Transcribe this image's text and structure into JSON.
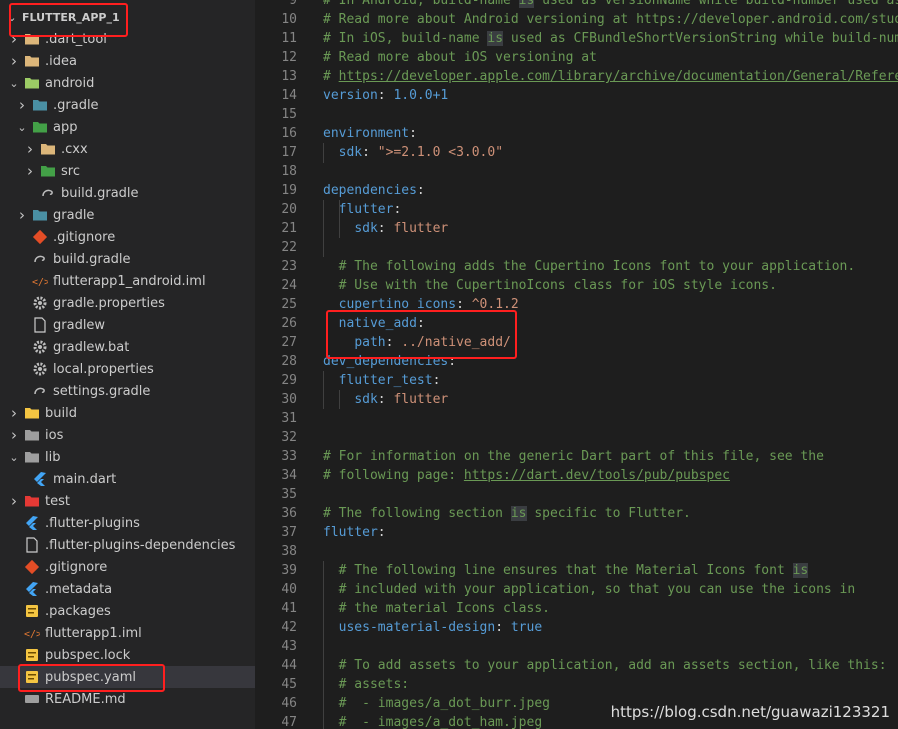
{
  "explorer": {
    "root": "FLUTTER_APP_1",
    "items": [
      {
        "label": ".dart_tool",
        "depth": 1,
        "twisty": "right",
        "icon": "folder-tools-icon",
        "color": "#dcb67a"
      },
      {
        "label": ".idea",
        "depth": 1,
        "twisty": "right",
        "icon": "folder-idea-icon",
        "color": "#dcb67a"
      },
      {
        "label": "android",
        "depth": 1,
        "twisty": "down",
        "icon": "folder-android-icon",
        "color": "#9ccc65"
      },
      {
        "label": ".gradle",
        "depth": 2,
        "twisty": "right",
        "icon": "folder-gradle-icon",
        "color": "#4a90a4"
      },
      {
        "label": "app",
        "depth": 2,
        "twisty": "down",
        "icon": "folder-app-icon",
        "color": "#43a047"
      },
      {
        "label": ".cxx",
        "depth": 3,
        "twisty": "right",
        "icon": "folder-icon",
        "color": "#dcb67a"
      },
      {
        "label": "src",
        "depth": 3,
        "twisty": "right",
        "icon": "folder-src-icon",
        "color": "#43a047"
      },
      {
        "label": "build.gradle",
        "depth": 3,
        "twisty": "none",
        "icon": "gradle-file-icon",
        "color": "#bdbdbd"
      },
      {
        "label": "gradle",
        "depth": 2,
        "twisty": "right",
        "icon": "folder-gradle-icon",
        "color": "#4a90a4"
      },
      {
        "label": ".gitignore",
        "depth": 2,
        "twisty": "none",
        "icon": "git-icon",
        "color": "#e44d26"
      },
      {
        "label": "build.gradle",
        "depth": 2,
        "twisty": "none",
        "icon": "gradle-file-icon",
        "color": "#bdbdbd"
      },
      {
        "label": "flutterapp1_android.iml",
        "depth": 2,
        "twisty": "none",
        "icon": "xml-icon",
        "color": "#e37933"
      },
      {
        "label": "gradle.properties",
        "depth": 2,
        "twisty": "none",
        "icon": "settings-gear-icon",
        "color": "#bdbdbd"
      },
      {
        "label": "gradlew",
        "depth": 2,
        "twisty": "none",
        "icon": "file-icon",
        "color": "#cccccc"
      },
      {
        "label": "gradlew.bat",
        "depth": 2,
        "twisty": "none",
        "icon": "windows-gear-icon",
        "color": "#bdbdbd"
      },
      {
        "label": "local.properties",
        "depth": 2,
        "twisty": "none",
        "icon": "settings-gear-icon",
        "color": "#bdbdbd"
      },
      {
        "label": "settings.gradle",
        "depth": 2,
        "twisty": "none",
        "icon": "gradle-file-icon",
        "color": "#bdbdbd"
      },
      {
        "label": "build",
        "depth": 1,
        "twisty": "right",
        "icon": "folder-build-icon",
        "color": "#f4c542"
      },
      {
        "label": "ios",
        "depth": 1,
        "twisty": "right",
        "icon": "folder-ios-icon",
        "color": "#9e9e9e"
      },
      {
        "label": "lib",
        "depth": 1,
        "twisty": "down",
        "icon": "folder-lib-icon",
        "color": "#9e9e9e"
      },
      {
        "label": "main.dart",
        "depth": 2,
        "twisty": "none",
        "icon": "dart-icon",
        "color": "#42a5f5"
      },
      {
        "label": "test",
        "depth": 1,
        "twisty": "right",
        "icon": "folder-test-icon",
        "color": "#e53935"
      },
      {
        "label": ".flutter-plugins",
        "depth": 1,
        "twisty": "none",
        "icon": "flutter-icon",
        "color": "#42a5f5"
      },
      {
        "label": ".flutter-plugins-dependencies",
        "depth": 1,
        "twisty": "none",
        "icon": "file-icon",
        "color": "#cccccc"
      },
      {
        "label": ".gitignore",
        "depth": 1,
        "twisty": "none",
        "icon": "git-icon",
        "color": "#e44d26"
      },
      {
        "label": ".metadata",
        "depth": 1,
        "twisty": "none",
        "icon": "flutter-icon",
        "color": "#42a5f5"
      },
      {
        "label": ".packages",
        "depth": 1,
        "twisty": "none",
        "icon": "yaml-package-icon",
        "color": "#f4c542"
      },
      {
        "label": "flutterapp1.iml",
        "depth": 1,
        "twisty": "none",
        "icon": "xml-icon",
        "color": "#e37933"
      },
      {
        "label": "pubspec.lock",
        "depth": 1,
        "twisty": "none",
        "icon": "yaml-package-icon",
        "color": "#f4c542"
      },
      {
        "label": "pubspec.yaml",
        "depth": 1,
        "twisty": "none",
        "icon": "yaml-package-icon",
        "color": "#f4c542",
        "selected": true
      },
      {
        "label": "README.md",
        "depth": 1,
        "twisty": "none",
        "icon": "markdown-icon",
        "color": "#9e9e9e"
      }
    ]
  },
  "editor": {
    "lines": [
      {
        "n": "9",
        "tokens": [
          {
            "t": "# In Android, build-name ",
            "c": "comment"
          },
          {
            "t": "is",
            "c": "hl"
          },
          {
            "t": " used as versionName while build-number used as",
            "c": "comment"
          }
        ]
      },
      {
        "n": "10",
        "tokens": [
          {
            "t": "# Read more about Android versioning at https://developer.android.com/studi",
            "c": "comment"
          }
        ]
      },
      {
        "n": "11",
        "tokens": [
          {
            "t": "# In iOS, build-name ",
            "c": "comment"
          },
          {
            "t": "is",
            "c": "hl"
          },
          {
            "t": " used as CFBundleShortVersionString while build-numb",
            "c": "comment"
          }
        ]
      },
      {
        "n": "12",
        "tokens": [
          {
            "t": "# Read more about iOS versioning at",
            "c": "comment"
          }
        ]
      },
      {
        "n": "13",
        "tokens": [
          {
            "t": "# ",
            "c": "comment"
          },
          {
            "t": "https://developer.apple.com/library/archive/documentation/General/Referen",
            "c": "link"
          }
        ]
      },
      {
        "n": "14",
        "tokens": [
          {
            "t": "version",
            "c": "key"
          },
          {
            "t": ": ",
            "c": "plain"
          },
          {
            "t": "1.0.0+1",
            "c": "val"
          }
        ]
      },
      {
        "n": "15",
        "tokens": []
      },
      {
        "n": "16",
        "tokens": [
          {
            "t": "environment",
            "c": "key"
          },
          {
            "t": ":",
            "c": "plain"
          }
        ]
      },
      {
        "n": "17",
        "tokens": [
          {
            "t": "  ",
            "c": "plain"
          },
          {
            "t": "sdk",
            "c": "key"
          },
          {
            "t": ": ",
            "c": "plain"
          },
          {
            "t": "\">=2.1.0 <3.0.0\"",
            "c": "str"
          }
        ]
      },
      {
        "n": "18",
        "tokens": []
      },
      {
        "n": "19",
        "tokens": [
          {
            "t": "dependencies",
            "c": "key"
          },
          {
            "t": ":",
            "c": "plain"
          }
        ]
      },
      {
        "n": "20",
        "tokens": [
          {
            "t": "  ",
            "c": "plain"
          },
          {
            "t": "flutter",
            "c": "key"
          },
          {
            "t": ":",
            "c": "plain"
          }
        ]
      },
      {
        "n": "21",
        "tokens": [
          {
            "t": "    ",
            "c": "plain"
          },
          {
            "t": "sdk",
            "c": "key"
          },
          {
            "t": ": ",
            "c": "plain"
          },
          {
            "t": "flutter",
            "c": "str"
          }
        ]
      },
      {
        "n": "22",
        "tokens": []
      },
      {
        "n": "23",
        "tokens": [
          {
            "t": "  # The following adds the Cupertino Icons font to your application.",
            "c": "comment"
          }
        ]
      },
      {
        "n": "24",
        "tokens": [
          {
            "t": "  # Use with the CupertinoIcons class for iOS style icons.",
            "c": "comment"
          }
        ]
      },
      {
        "n": "25",
        "tokens": [
          {
            "t": "  ",
            "c": "plain"
          },
          {
            "t": "cupertino_icons",
            "c": "key"
          },
          {
            "t": ": ",
            "c": "plain"
          },
          {
            "t": "^0.1.2",
            "c": "str"
          }
        ]
      },
      {
        "n": "26",
        "tokens": [
          {
            "t": "  ",
            "c": "plain"
          },
          {
            "t": "native_add",
            "c": "key"
          },
          {
            "t": ":",
            "c": "plain"
          }
        ]
      },
      {
        "n": "27",
        "tokens": [
          {
            "t": "    ",
            "c": "plain"
          },
          {
            "t": "path",
            "c": "key"
          },
          {
            "t": ": ",
            "c": "plain"
          },
          {
            "t": "../native_add/",
            "c": "str"
          }
        ]
      },
      {
        "n": "28",
        "tokens": [
          {
            "t": "dev_dependencies",
            "c": "key"
          },
          {
            "t": ":",
            "c": "plain"
          }
        ]
      },
      {
        "n": "29",
        "tokens": [
          {
            "t": "  ",
            "c": "plain"
          },
          {
            "t": "flutter_test",
            "c": "key"
          },
          {
            "t": ":",
            "c": "plain"
          }
        ]
      },
      {
        "n": "30",
        "tokens": [
          {
            "t": "    ",
            "c": "plain"
          },
          {
            "t": "sdk",
            "c": "key"
          },
          {
            "t": ": ",
            "c": "plain"
          },
          {
            "t": "flutter",
            "c": "str"
          }
        ]
      },
      {
        "n": "31",
        "tokens": []
      },
      {
        "n": "32",
        "tokens": []
      },
      {
        "n": "33",
        "tokens": [
          {
            "t": "# For information on the generic Dart part of this file, see the",
            "c": "comment"
          }
        ]
      },
      {
        "n": "34",
        "tokens": [
          {
            "t": "# following page: ",
            "c": "comment"
          },
          {
            "t": "https://dart.dev/tools/pub/pubspec",
            "c": "link"
          }
        ]
      },
      {
        "n": "35",
        "tokens": []
      },
      {
        "n": "36",
        "tokens": [
          {
            "t": "# The following section ",
            "c": "comment"
          },
          {
            "t": "is",
            "c": "hl"
          },
          {
            "t": " specific to Flutter.",
            "c": "comment"
          }
        ]
      },
      {
        "n": "37",
        "tokens": [
          {
            "t": "flutter",
            "c": "key"
          },
          {
            "t": ":",
            "c": "plain"
          }
        ]
      },
      {
        "n": "38",
        "tokens": []
      },
      {
        "n": "39",
        "tokens": [
          {
            "t": "  # The following line ensures that the Material Icons font ",
            "c": "comment"
          },
          {
            "t": "is",
            "c": "hl"
          }
        ]
      },
      {
        "n": "40",
        "tokens": [
          {
            "t": "  # included with your application, so that you can use the icons in",
            "c": "comment"
          }
        ]
      },
      {
        "n": "41",
        "tokens": [
          {
            "t": "  # the material Icons class.",
            "c": "comment"
          }
        ]
      },
      {
        "n": "42",
        "tokens": [
          {
            "t": "  ",
            "c": "plain"
          },
          {
            "t": "uses-material-design",
            "c": "key"
          },
          {
            "t": ": ",
            "c": "plain"
          },
          {
            "t": "true",
            "c": "val"
          }
        ]
      },
      {
        "n": "43",
        "tokens": []
      },
      {
        "n": "44",
        "tokens": [
          {
            "t": "  # To add assets to your application, add an assets section, like this:",
            "c": "comment"
          }
        ]
      },
      {
        "n": "45",
        "tokens": [
          {
            "t": "  # assets:",
            "c": "comment"
          }
        ]
      },
      {
        "n": "46",
        "tokens": [
          {
            "t": "  #  - images/a_dot_burr.jpeg",
            "c": "comment"
          }
        ]
      },
      {
        "n": "47",
        "tokens": [
          {
            "t": "  #  - images/a_dot_ham.jpeg",
            "c": "comment"
          }
        ]
      }
    ]
  },
  "watermark": "https://blog.csdn.net/guawazi123321",
  "colors": {
    "annotation": "#ff1f1f",
    "sidebar_bg": "#252526",
    "editor_bg": "#1e1e1e",
    "selection_bg": "#37373d"
  }
}
